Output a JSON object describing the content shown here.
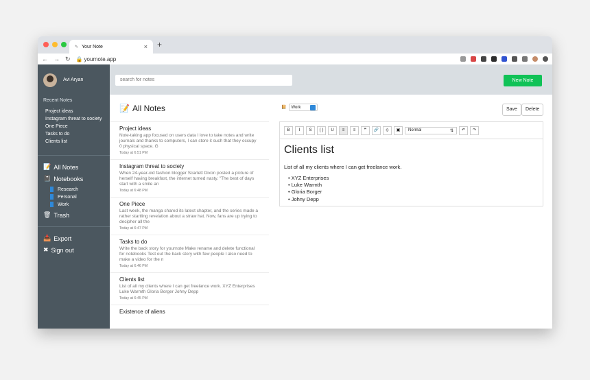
{
  "browser": {
    "tab_title": "Your Note",
    "url": "yournote.app",
    "new_tab": "+",
    "close_tab": "×"
  },
  "sidebar": {
    "user_name": "Avi Aryan",
    "recent_notes_title": "Recent Notes",
    "recent_notes": [
      "Project ideas",
      "Instagram threat to society",
      "One Piece",
      "Tasks to do",
      "Clients list"
    ],
    "all_notes": "All Notes",
    "notebooks": "Notebooks",
    "notebook_items": [
      "Research",
      "Personal",
      "Work"
    ],
    "trash": "Trash",
    "export": "Export",
    "sign_out": "Sign out"
  },
  "topbar": {
    "search_placeholder": "search for notes",
    "new_note": "New Note"
  },
  "notes_panel": {
    "title": "All Notes",
    "notes": [
      {
        "title": "Project ideas",
        "body": "Note-taking app focused on users data I love to take notes and write journals and thanks to computers, I can store it such that they occupy 0 physical space. G",
        "time": "Today at 6:51 PM"
      },
      {
        "title": "Instagram threat to society",
        "body": "When 24-year-old fashion blogger Scarlett Dixon posted a picture of herself having breakfast, the internet turned nasty. \"The best of days start with a smile an",
        "time": "Today at 6:48 PM"
      },
      {
        "title": "One Piece",
        "body": "Last week, the manga shared its latest chapter, and the series made a rather startling revelation about a straw hat. Now, fans are up trying to decipher all the",
        "time": "Today at 6:47 PM"
      },
      {
        "title": "Tasks to do",
        "body": "Write the back story for yournote Make rename and delete functional for notebooks Test out the back story with few people I also need to make a video for the n",
        "time": "Today at 6:46 PM"
      },
      {
        "title": "Clients list",
        "body": "List of all my clients where I can get freelance work. XYZ Enterprises Luke Warmth Gloria Borger Johny Depp",
        "time": "Today at 6:45 PM"
      },
      {
        "title": "Existence of aliens",
        "body": "",
        "time": ""
      }
    ]
  },
  "editor": {
    "notebook_selected": "Work",
    "save": "Save",
    "delete": "Delete",
    "format_selected": "Normal",
    "heading": "Clients list",
    "paragraph": "List of all my clients where I can get freelance work.",
    "list": [
      "XYZ Enterprises",
      "Luke Warmth",
      "Gloria Borger",
      "Johny Depp"
    ],
    "toolbar": [
      "B",
      "I",
      "S",
      "{ }",
      "U",
      "≡",
      "≡",
      "❞",
      "🔗",
      "⦸",
      "▣",
      "↶",
      "↷"
    ]
  }
}
